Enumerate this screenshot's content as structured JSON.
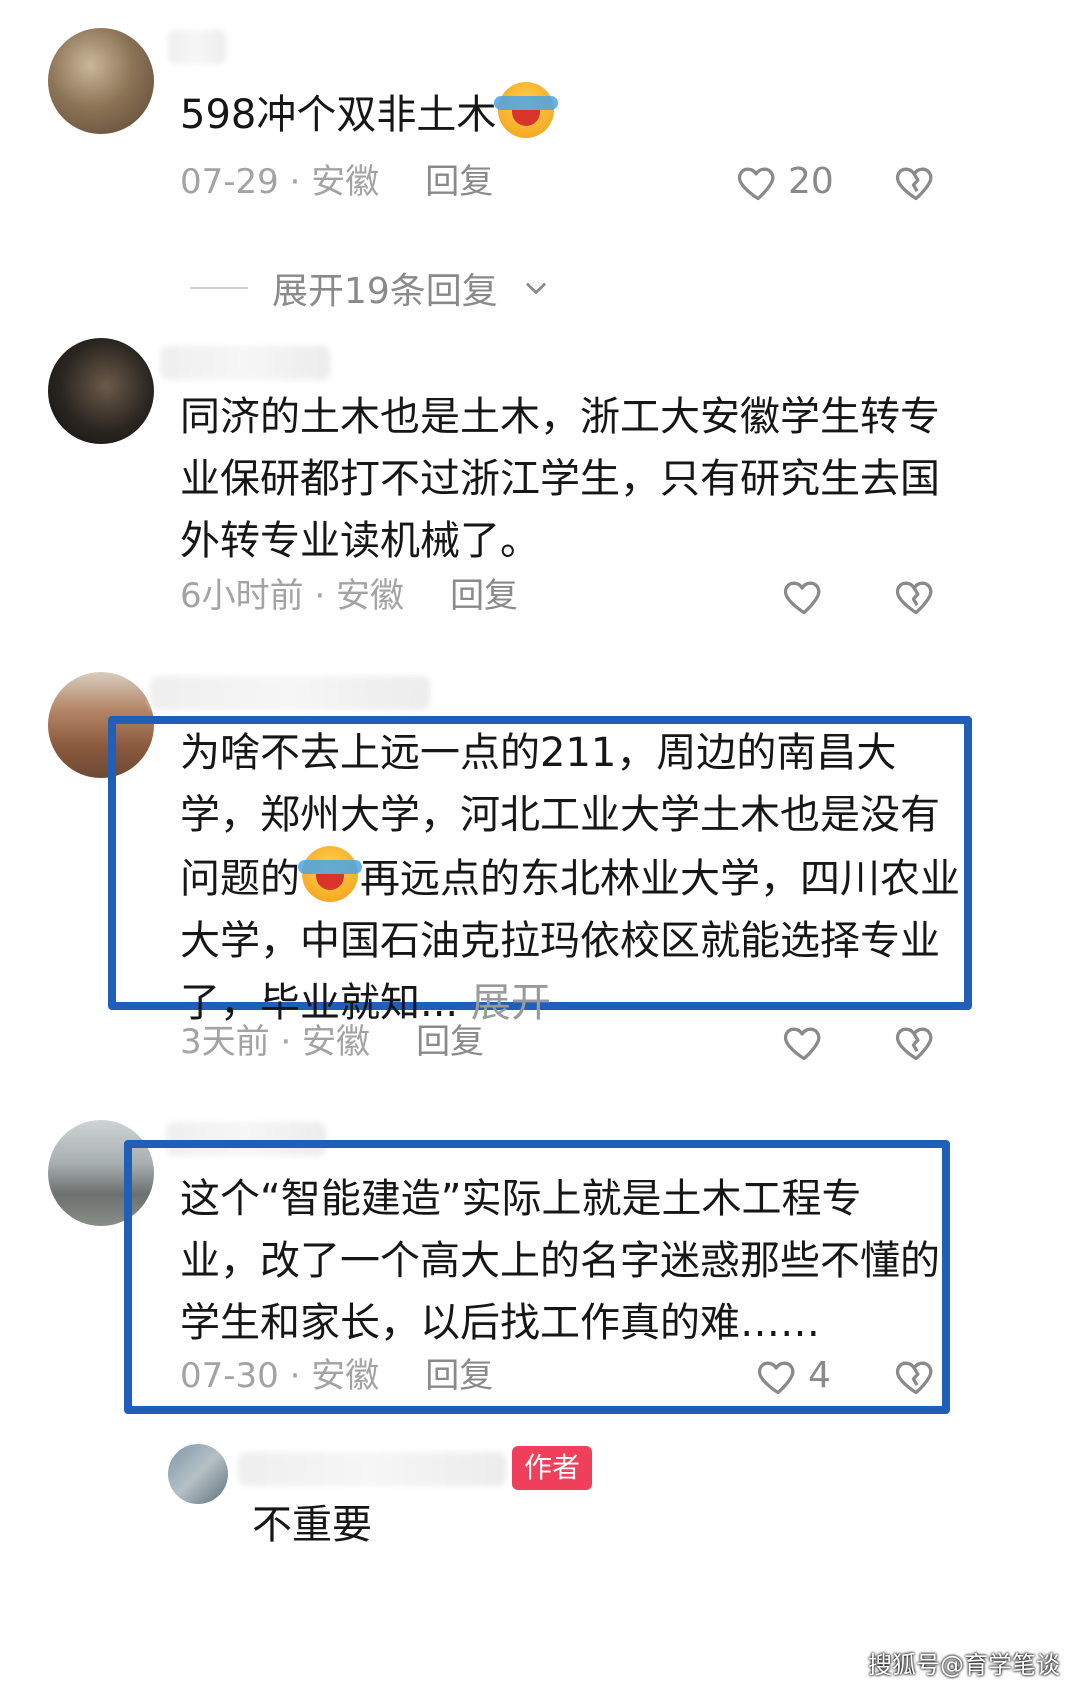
{
  "comments": [
    {
      "text": "598冲个双非土木",
      "date": "07-29 · 安徽",
      "reply": "回复",
      "likes": "20",
      "expand_replies": "展开19条回复"
    },
    {
      "text": "同济的土木也是土木，浙工大安徽学生转专业保研都打不过浙江学生，只有研究生去国外转专业读机械了。",
      "date": "6小时前 · 安徽",
      "reply": "回复",
      "likes": ""
    },
    {
      "text_part1": "为啥不去上远一点的211，周边的南昌大学，郑州大学，河北工业大学土木也是没有问题的",
      "text_part2": "再远点的东北林业大学，四川农业大学，中国石油克拉玛依校区就能选择专业了，毕业就知...",
      "expand": "展开",
      "date": "3天前 · 安徽",
      "reply": "回复",
      "likes": ""
    },
    {
      "text": "这个“智能建造”实际上就是土木工程专业，改了一个高大上的名字迷惑那些不懂的学生和家长，以后找工作真的难……",
      "date": "07-30 · 安徽",
      "reply": "回复",
      "likes": "4"
    }
  ],
  "author_reply": {
    "badge": "作者",
    "text": "不重要"
  },
  "watermark": "搜狐号@育学笔谈",
  "colors": {
    "highlight": "#1f5fb8",
    "author_badge": "#ef3f5a"
  }
}
